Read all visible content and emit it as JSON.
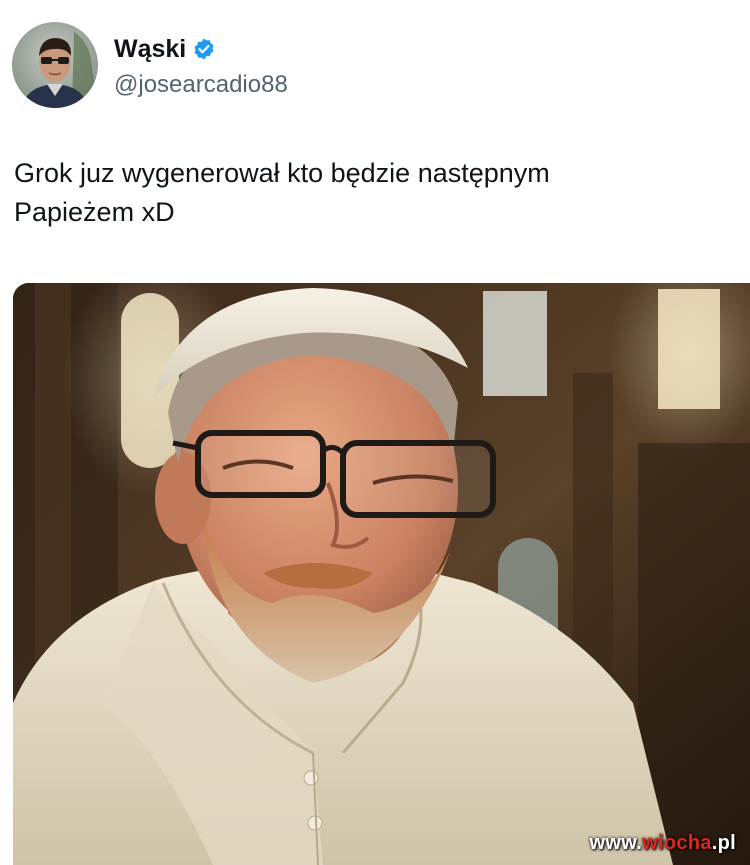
{
  "author": {
    "display_name": "Wąski",
    "handle": "@josearcadio88",
    "verified": true,
    "avatar": "profile-photo-man-sunglasses"
  },
  "tweet": {
    "text_line1": "Grok juz wygenerował kto będzie następnym",
    "text_line2": "Papieżem xD"
  },
  "media": {
    "image": "ai-generated-bearded-man-in-white-papal-cassock-and-zucchetto-with-glasses-in-church"
  },
  "watermark": {
    "prefix": "www.",
    "brand": "wiocha",
    "suffix": ".pl"
  },
  "colors": {
    "verified_badge": "#1d9bf0",
    "text": "#0f1419",
    "secondary_text": "#536471",
    "watermark_accent": "#e2261c"
  }
}
